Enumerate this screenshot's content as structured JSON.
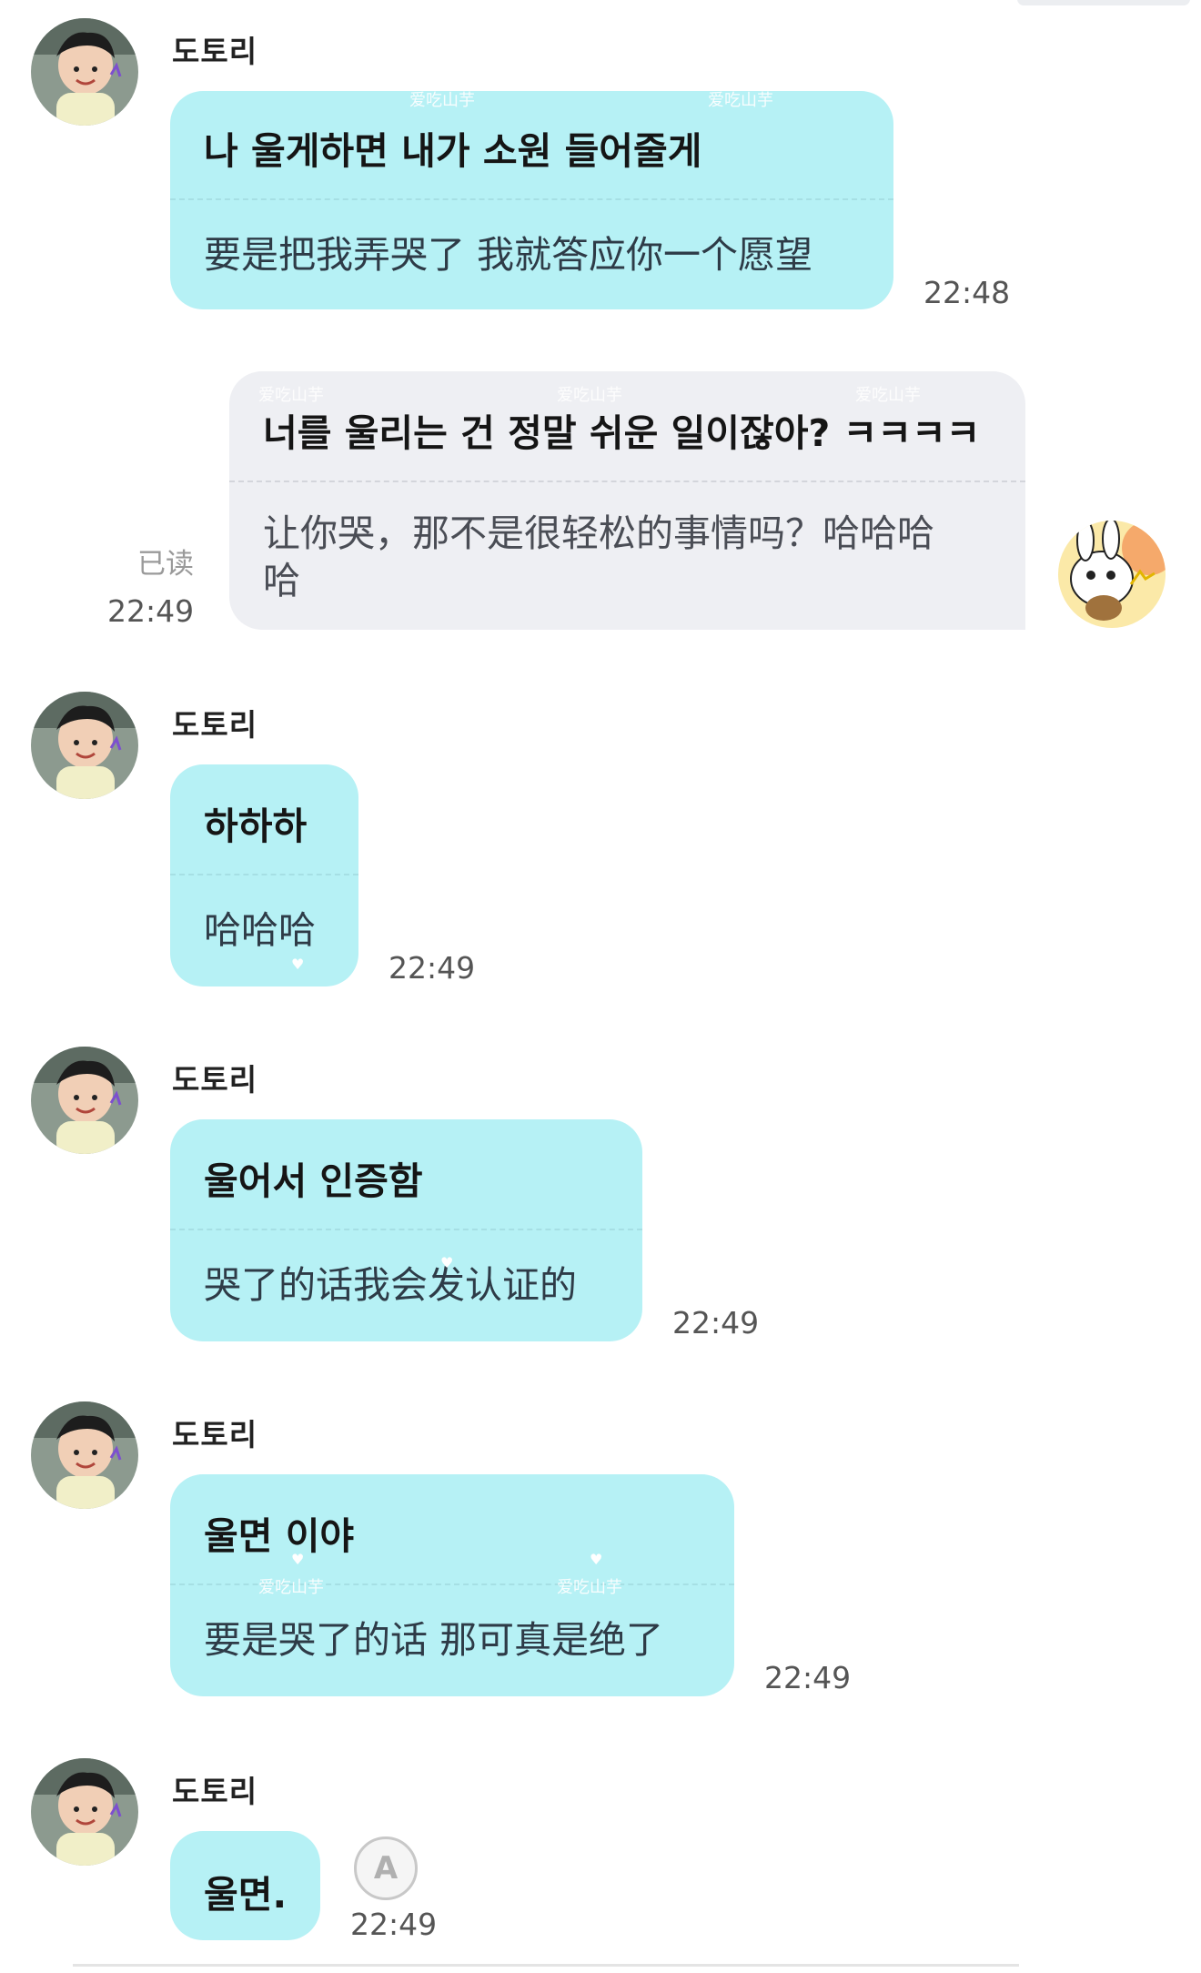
{
  "messages": [
    {
      "sender": "도토리",
      "side": "left",
      "korean": "나 울게하면 내가 소원 들어줄게",
      "chinese": "要是把我弄哭了 我就答应你一个愿望",
      "time": "22:48"
    },
    {
      "side": "right",
      "korean": "너를 울리는 건 정말 쉬운 일이잖아? ㅋㅋㅋㅋ",
      "chinese_line1": "让你哭，那不是很轻松的事情吗？哈哈哈",
      "chinese_line2": "哈",
      "read_status": "已读",
      "time": "22:49"
    },
    {
      "sender": "도토리",
      "side": "left",
      "korean": "하하하",
      "chinese": "哈哈哈",
      "time": "22:49"
    },
    {
      "sender": "도토리",
      "side": "left",
      "korean": "울어서 인증함",
      "chinese": "哭了的话我会发认证的",
      "time": "22:49"
    },
    {
      "sender": "도토리",
      "side": "left",
      "korean": "울면 이야",
      "chinese": "要是哭了的话 那可真是绝了",
      "time": "22:49"
    },
    {
      "sender": "도토리",
      "side": "left",
      "korean": "울면.",
      "time": "22:49",
      "translate_icon": "A"
    }
  ],
  "watermark": "爱吃山芋",
  "colors": {
    "mint_bubble": "#b6f1f5",
    "gray_bubble": "#eeeff3",
    "background": "#ffffff"
  }
}
